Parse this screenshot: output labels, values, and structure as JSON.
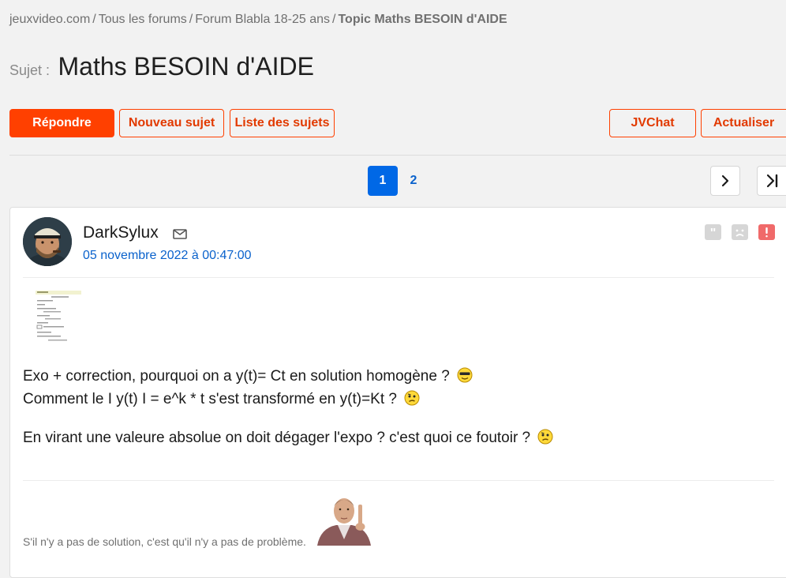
{
  "breadcrumb": {
    "items": [
      "jeuxvideo.com",
      "Tous les forums",
      "Forum Blabla 18-25 ans"
    ],
    "separator": "/",
    "current": "Topic Maths BESOIN d'AIDE"
  },
  "topic": {
    "prefix": "Sujet :",
    "title": "Maths BESOIN d'AIDE"
  },
  "toolbar": {
    "reply_label": "Répondre",
    "new_topic_label": "Nouveau sujet",
    "topic_list_label": "Liste des sujets",
    "jvchat_label": "JVChat",
    "refresh_label": "Actualiser"
  },
  "pagination": {
    "pages": [
      "1",
      "2"
    ],
    "current": "1",
    "next_icon": "chevron-right-icon",
    "last_icon": "last-page-icon"
  },
  "post": {
    "author": "DarkSylux",
    "date": "05 novembre 2022 à 00:47:00",
    "lines": [
      "Exo + correction, pourquoi on a y(t)= Ct en solution homogène ?",
      "Comment le I y(t) I = e^k * t s'est transformé en y(t)=Kt ?",
      "En virant une valeure absolue on doit dégager l'expo ? c'est quoi ce foutoir ?"
    ],
    "signature": "S'il n'y a pas de solution, c'est qu'il n'y a pas de problème."
  },
  "colors": {
    "accent": "#ff4000",
    "link": "#0a62cc",
    "page_active": "#0068e6",
    "alert": "#f06a6a"
  }
}
